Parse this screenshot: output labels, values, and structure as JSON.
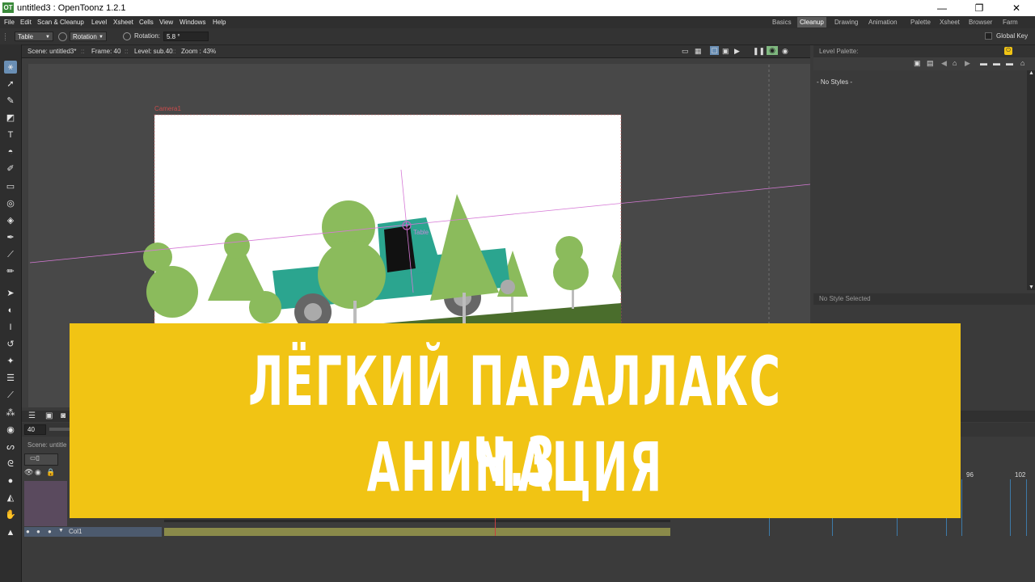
{
  "window": {
    "logo": "OT",
    "title": "untitled3 : OpenToonz 1.2.1",
    "controls": [
      "—",
      "❐",
      "✕"
    ]
  },
  "menu": [
    "File",
    "Edit",
    "Scan & Cleanup",
    "Level",
    "Xsheet",
    "Cells",
    "View",
    "Windows",
    "Help"
  ],
  "rooms": [
    "Basics",
    "Cleanup",
    "Drawing",
    "Animation",
    "Palette",
    "Xsheet",
    "Browser",
    "Farm"
  ],
  "active_room": "Cleanup",
  "tool_options": {
    "target_value": "Table",
    "mode_value": "Rotation",
    "rotation_label": "Rotation:",
    "rotation_value": "5.8 °",
    "global_key_label": "Global Key"
  },
  "viewer": {
    "scene": "Scene: untitled3*",
    "frame": "Frame: 40",
    "level": "Level: sub.40",
    "zoom": "Zoom : 43%",
    "camera_label": "Camera1",
    "table_label": "Table"
  },
  "level_palette": {
    "title": "Level Palette:",
    "empty_text": "- No Styles -",
    "style_editor_text": "No Style Selected"
  },
  "xsheet": {
    "frame_field": "40",
    "scene_label": "Scene: untitle",
    "column_name": "Col1",
    "frame_markers": [
      "96",
      "102"
    ]
  },
  "banner": {
    "line1": "ЛЁГКИЙ ПАРАЛЛАКС Ч.3",
    "line2": "АНИМАЦИЯ",
    "color": "#f1c414"
  }
}
